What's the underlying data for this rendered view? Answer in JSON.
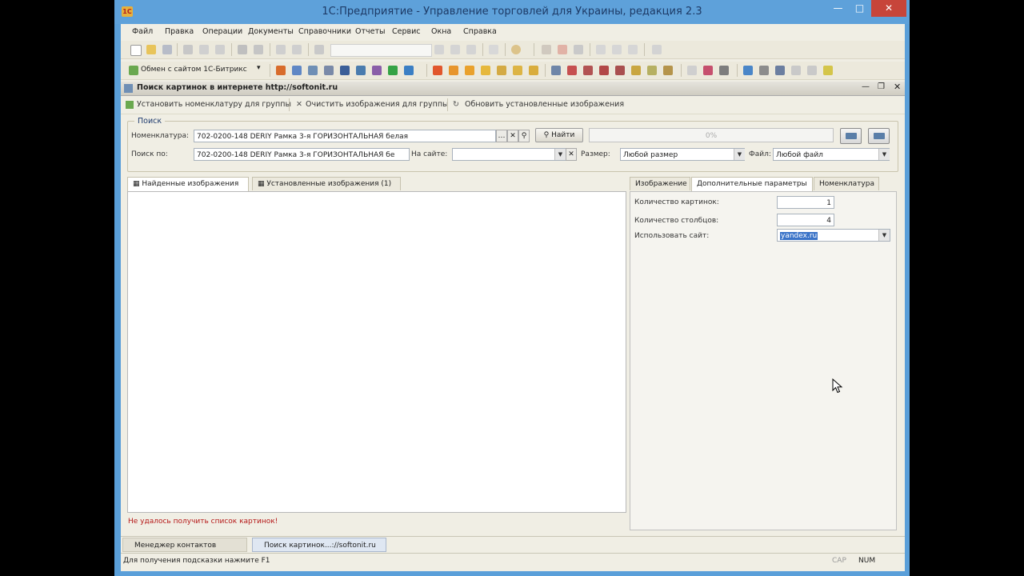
{
  "window": {
    "title": "1С:Предприятие - Управление торговлей для Украины, редакция 2.3",
    "app_icon": "1С"
  },
  "menu": [
    "Файл",
    "Правка",
    "Операции",
    "Документы",
    "Справочники",
    "Отчеты",
    "Сервис",
    "Окна",
    "Справка"
  ],
  "toolbar2": {
    "exchange_label": "Обмен с сайтом 1С-Битрикс"
  },
  "doc": {
    "title": "Поиск картинок в интернете http://softonit.ru"
  },
  "actions": {
    "set_nomenclature": "Установить номенклатуру для группы",
    "clear_images": "Очистить изображения для группы",
    "refresh_images": "Обновить установленные изображения"
  },
  "search": {
    "group_label": "Поиск",
    "nomenclature_label": "Номенклатура:",
    "nomenclature_value": "702-0200-148 DERIY Рамка 3-я ГОРИЗОНТАЛЬНАЯ белая",
    "find_button": "Найти",
    "progress": "0%",
    "search_by_label": "Поиск по:",
    "search_by_value": "702-0200-148 DERIY Рамка 3-я ГОРИЗОНТАЛЬНАЯ бе",
    "site_label": "На сайте:",
    "site_value": "",
    "size_label": "Размер:",
    "size_value": "Любой размер",
    "file_label": "Файл:",
    "file_value": "Любой файл"
  },
  "left_tabs": [
    "Найденные изображения",
    "Установленные изображения (1)"
  ],
  "right_tabs": [
    "Изображение",
    "Дополнительные параметры",
    "Номенклатура"
  ],
  "params": {
    "count_label": "Количество картинок:",
    "count_value": "1",
    "columns_label": "Количество столбцов:",
    "columns_value": "4",
    "site_label": "Использовать сайт:",
    "site_value": "yandex.ru"
  },
  "error_text": "Не удалось получить список картинок!",
  "window_tabs": [
    "Менеджер контактов",
    "Поиск картинок...://softonit.ru"
  ],
  "status": {
    "hint": "Для получения подсказки нажмите F1",
    "cap": "CAP",
    "num": "NUM"
  }
}
